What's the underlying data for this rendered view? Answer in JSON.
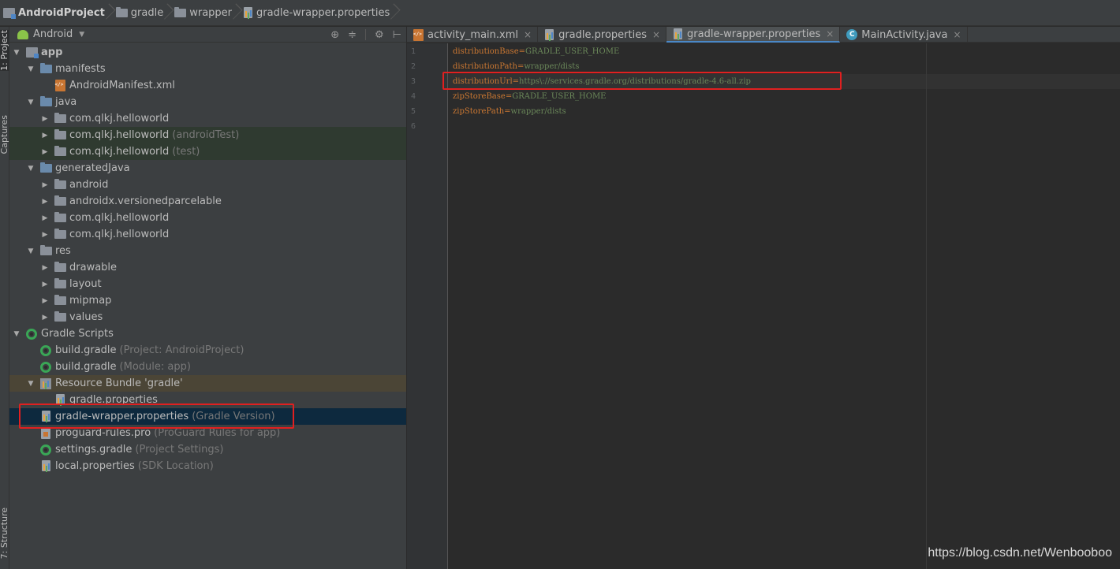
{
  "breadcrumb": [
    {
      "label": "AndroidProject",
      "icon": "module-icon"
    },
    {
      "label": "gradle",
      "icon": "folder-icon"
    },
    {
      "label": "wrapper",
      "icon": "folder-icon"
    },
    {
      "label": "gradle-wrapper.properties",
      "icon": "properties-file-icon"
    }
  ],
  "toolwindow": {
    "project_label": "1: Project",
    "captures_label": "Captures",
    "structure_label": "7: Structure"
  },
  "project_panel": {
    "view_mode": "Android",
    "tree": [
      {
        "name": "app",
        "hint": ""
      },
      {
        "name": "manifests",
        "hint": ""
      },
      {
        "name": "AndroidManifest.xml",
        "hint": ""
      },
      {
        "name": "java",
        "hint": ""
      },
      {
        "name": "com.qlkj.helloworld",
        "hint": ""
      },
      {
        "name": "com.qlkj.helloworld",
        "hint": "(androidTest)"
      },
      {
        "name": "com.qlkj.helloworld",
        "hint": "(test)"
      },
      {
        "name": "generatedJava",
        "hint": ""
      },
      {
        "name": "android",
        "hint": ""
      },
      {
        "name": "androidx.versionedparcelable",
        "hint": ""
      },
      {
        "name": "com.qlkj.helloworld",
        "hint": ""
      },
      {
        "name": "com.qlkj.helloworld",
        "hint": ""
      },
      {
        "name": "res",
        "hint": ""
      },
      {
        "name": "drawable",
        "hint": ""
      },
      {
        "name": "layout",
        "hint": ""
      },
      {
        "name": "mipmap",
        "hint": ""
      },
      {
        "name": "values",
        "hint": ""
      },
      {
        "name": "Gradle Scripts",
        "hint": ""
      },
      {
        "name": "build.gradle",
        "hint": "(Project: AndroidProject)"
      },
      {
        "name": "build.gradle",
        "hint": "(Module: app)"
      },
      {
        "name": "Resource Bundle 'gradle'",
        "hint": ""
      },
      {
        "name": "gradle.properties",
        "hint": ""
      },
      {
        "name": "gradle-wrapper.properties",
        "hint": "(Gradle Version)"
      },
      {
        "name": "proguard-rules.pro",
        "hint": "(ProGuard Rules for app)"
      },
      {
        "name": "settings.gradle",
        "hint": "(Project Settings)"
      },
      {
        "name": "local.properties",
        "hint": "(SDK Location)"
      }
    ]
  },
  "editor": {
    "tabs": [
      {
        "label": "activity_main.xml",
        "icon": "xml-file-icon"
      },
      {
        "label": "gradle.properties",
        "icon": "properties-file-icon"
      },
      {
        "label": "gradle-wrapper.properties",
        "icon": "properties-file-icon"
      },
      {
        "label": "MainActivity.java",
        "icon": "java-class-icon"
      }
    ],
    "active_tab": "gradle-wrapper.properties",
    "lines": [
      {
        "num": "1",
        "key": "distributionBase",
        "value": "GRADLE_USER_HOME"
      },
      {
        "num": "2",
        "key": "distributionPath",
        "value": "wrapper/dists"
      },
      {
        "num": "3",
        "key": "distributionUrl",
        "value": "https\\://services.gradle.org/distributions/gradle-4.6-all.zip"
      },
      {
        "num": "4",
        "key": "zipStoreBase",
        "value": "GRADLE_USER_HOME"
      },
      {
        "num": "5",
        "key": "zipStorePath",
        "value": "wrapper/dists"
      },
      {
        "num": "6",
        "key": "",
        "value": ""
      }
    ],
    "equals": "="
  },
  "watermark": "https://blog.csdn.net/Wenbooboo",
  "colors": {
    "highlight_box": "#e02020",
    "selection": "#0d293e",
    "keyword": "#cc7832",
    "string_value": "#6a8759"
  }
}
